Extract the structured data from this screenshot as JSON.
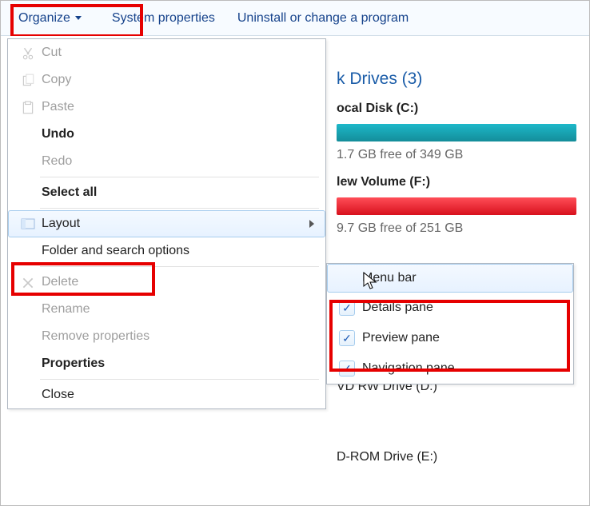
{
  "toolbar": {
    "organize": "Organize",
    "system_properties": "System properties",
    "uninstall": "Uninstall or change a program"
  },
  "drives": {
    "section_title_fragment": "k Drives (3)",
    "c": {
      "title_fragment": "ocal Disk (C:)",
      "free_fragment": "1.7 GB free of 349 GB"
    },
    "f": {
      "title_fragment": "lew Volume (F:)",
      "free_fragment": "9.7 GB free of 251 GB"
    },
    "d": {
      "title_fragment": "VD RW Drive (D:)"
    },
    "e": {
      "title_fragment": "D-ROM Drive (E:)"
    }
  },
  "organize_menu": {
    "cut": "Cut",
    "copy": "Copy",
    "paste": "Paste",
    "undo": "Undo",
    "redo": "Redo",
    "select_all": "Select all",
    "layout": "Layout",
    "folder_options": "Folder and search options",
    "delete": "Delete",
    "rename": "Rename",
    "remove_props": "Remove properties",
    "properties": "Properties",
    "close": "Close"
  },
  "layout_menu": {
    "menu_bar": "Menu bar",
    "details_pane": "Details pane",
    "preview_pane": "Preview pane",
    "navigation_pane": "Navigation pane"
  }
}
